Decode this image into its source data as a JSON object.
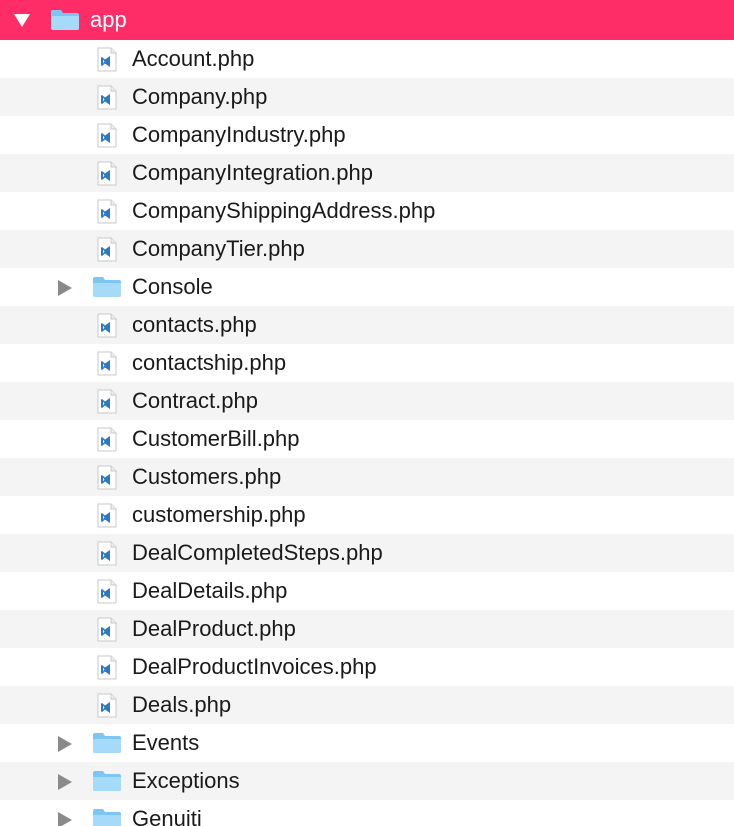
{
  "root": {
    "label": "app",
    "icon": "folder-icon",
    "expanded": true,
    "highlight_color": "#ff2d67"
  },
  "items": [
    {
      "type": "file",
      "label": "Account.php",
      "icon": "vscode-php-file-icon"
    },
    {
      "type": "file",
      "label": "Company.php",
      "icon": "vscode-php-file-icon"
    },
    {
      "type": "file",
      "label": "CompanyIndustry.php",
      "icon": "vscode-php-file-icon"
    },
    {
      "type": "file",
      "label": "CompanyIntegration.php",
      "icon": "vscode-php-file-icon"
    },
    {
      "type": "file",
      "label": "CompanyShippingAddress.php",
      "icon": "vscode-php-file-icon"
    },
    {
      "type": "file",
      "label": "CompanyTier.php",
      "icon": "vscode-php-file-icon"
    },
    {
      "type": "folder",
      "label": "Console",
      "icon": "folder-icon",
      "expanded": false
    },
    {
      "type": "file",
      "label": "contacts.php",
      "icon": "vscode-php-file-icon"
    },
    {
      "type": "file",
      "label": "contactship.php",
      "icon": "vscode-php-file-icon"
    },
    {
      "type": "file",
      "label": "Contract.php",
      "icon": "vscode-php-file-icon"
    },
    {
      "type": "file",
      "label": "CustomerBill.php",
      "icon": "vscode-php-file-icon"
    },
    {
      "type": "file",
      "label": "Customers.php",
      "icon": "vscode-php-file-icon"
    },
    {
      "type": "file",
      "label": "customership.php",
      "icon": "vscode-php-file-icon"
    },
    {
      "type": "file",
      "label": "DealCompletedSteps.php",
      "icon": "vscode-php-file-icon"
    },
    {
      "type": "file",
      "label": "DealDetails.php",
      "icon": "vscode-php-file-icon"
    },
    {
      "type": "file",
      "label": "DealProduct.php",
      "icon": "vscode-php-file-icon"
    },
    {
      "type": "file",
      "label": "DealProductInvoices.php",
      "icon": "vscode-php-file-icon"
    },
    {
      "type": "file",
      "label": "Deals.php",
      "icon": "vscode-php-file-icon"
    },
    {
      "type": "folder",
      "label": "Events",
      "icon": "folder-icon",
      "expanded": false
    },
    {
      "type": "folder",
      "label": "Exceptions",
      "icon": "folder-icon",
      "expanded": false
    },
    {
      "type": "folder",
      "label": "Genuiti",
      "icon": "folder-icon",
      "expanded": false
    }
  ],
  "colors": {
    "row_alt": "#f4f4f4",
    "folder_blue": "#7cc6f5",
    "file_icon_blue": "#2b79c2"
  }
}
